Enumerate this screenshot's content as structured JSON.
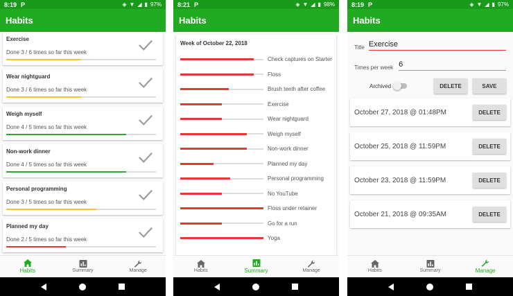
{
  "colors": {
    "primary": "#22aa22",
    "primary_dark": "#1a9a1a",
    "red": "#e53935",
    "yellow": "#fbc02d",
    "green": "#2ea82e"
  },
  "screens": [
    {
      "status": {
        "time": "8:19",
        "badge": "P",
        "battery": "97%"
      },
      "title": "Habits",
      "habits": [
        {
          "name": "Exercise",
          "progress_text": "Done 3 / 6 times so far this week",
          "progress": 0.5,
          "color": "#fbc02d"
        },
        {
          "name": "Wear nightguard",
          "progress_text": "Done 3 / 6 times so far this week",
          "progress": 0.5,
          "color": "#fbc02d"
        },
        {
          "name": "Weigh myself",
          "progress_text": "Done 4 / 5 times so far this week",
          "progress": 0.8,
          "color": "#2ea82e"
        },
        {
          "name": "Non-work dinner",
          "progress_text": "Done 4 / 5 times so far this week",
          "progress": 0.8,
          "color": "#2ea82e"
        },
        {
          "name": "Personal programming",
          "progress_text": "Done 3 / 5 times so far this week",
          "progress": 0.6,
          "color": "#fbc02d"
        },
        {
          "name": "Planned my day",
          "progress_text": "Done 2 / 5 times so far this week",
          "progress": 0.4,
          "color": "#e53935"
        }
      ],
      "nav_active": 0
    },
    {
      "status": {
        "time": "8:21",
        "badge": "P",
        "battery": "98%"
      },
      "title": "Habits",
      "week_label": "Week of October 22, 2018",
      "summary": [
        {
          "name": "Check captures on Starter",
          "progress": 0.88
        },
        {
          "name": "Floss",
          "progress": 0.88
        },
        {
          "name": "Brush teeth after coffee",
          "progress": 0.58
        },
        {
          "name": "Exercise",
          "progress": 0.5
        },
        {
          "name": "Wear nightguard",
          "progress": 0.5
        },
        {
          "name": "Weigh myself",
          "progress": 0.8
        },
        {
          "name": "Non-work dinner",
          "progress": 0.8
        },
        {
          "name": "Planned my day",
          "progress": 0.4
        },
        {
          "name": "Personal programming",
          "progress": 0.6
        },
        {
          "name": "No YouTube",
          "progress": 0.5
        },
        {
          "name": "Floss under retainer",
          "progress": 1.0
        },
        {
          "name": "Go for a run",
          "progress": 0.5
        },
        {
          "name": "Yoga",
          "progress": 1.0
        }
      ],
      "nav_active": 1
    },
    {
      "status": {
        "time": "8:19",
        "badge": "P",
        "battery": "97%"
      },
      "title": "Habits",
      "form": {
        "title_label": "Title",
        "title_value": "Exercise",
        "times_label": "Times per week",
        "times_value": "6",
        "archived_label": "Archived",
        "archived": false,
        "delete_label": "DELETE",
        "save_label": "SAVE"
      },
      "entries": [
        {
          "date": "October 27, 2018  @ 01:48PM",
          "delete_label": "DELETE"
        },
        {
          "date": "October 25, 2018  @ 11:59PM",
          "delete_label": "DELETE"
        },
        {
          "date": "October 23, 2018  @ 11:59PM",
          "delete_label": "DELETE"
        },
        {
          "date": "October 21, 2018  @ 09:35AM",
          "delete_label": "DELETE"
        }
      ],
      "nav_active": 2
    }
  ],
  "nav": [
    {
      "label": "Habits",
      "icon": "home-icon"
    },
    {
      "label": "Summary",
      "icon": "bar-chart-icon"
    },
    {
      "label": "Manage",
      "icon": "wrench-icon"
    }
  ]
}
